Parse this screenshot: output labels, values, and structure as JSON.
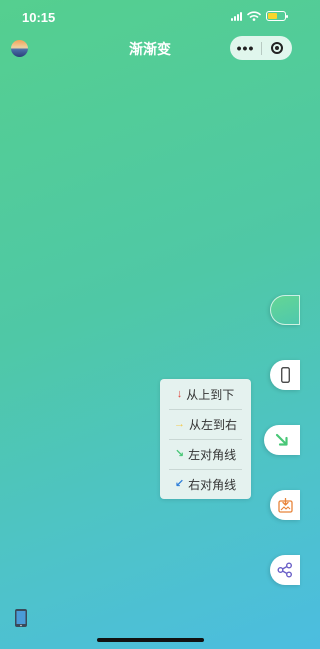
{
  "status": {
    "time": "10:15"
  },
  "nav": {
    "title": "渐渐变",
    "more_icon": "•••"
  },
  "side_tabs": [
    {
      "name": "gradient-swatch",
      "icon": "gradient-swatch-icon"
    },
    {
      "name": "phone",
      "icon": "phone-outline-icon"
    },
    {
      "name": "direction",
      "icon": "arrow-down-right-icon"
    },
    {
      "name": "save",
      "icon": "save-image-icon"
    },
    {
      "name": "share",
      "icon": "share-icon"
    }
  ],
  "direction_menu": {
    "items": [
      {
        "label": "从上到下",
        "arrow": "↓",
        "arrow_color": "#e0463b"
      },
      {
        "label": "从左到右",
        "arrow": "→",
        "arrow_color": "#f2c94c"
      },
      {
        "label": "左对角线",
        "arrow": "↘",
        "arrow_color": "#49c777"
      },
      {
        "label": "右对角线",
        "arrow": "↙",
        "arrow_color": "#2f7fd9"
      }
    ]
  },
  "colors": {
    "accent_green": "#49c777",
    "save_orange": "#e8843a",
    "share_purple": "#6a5fc7"
  }
}
